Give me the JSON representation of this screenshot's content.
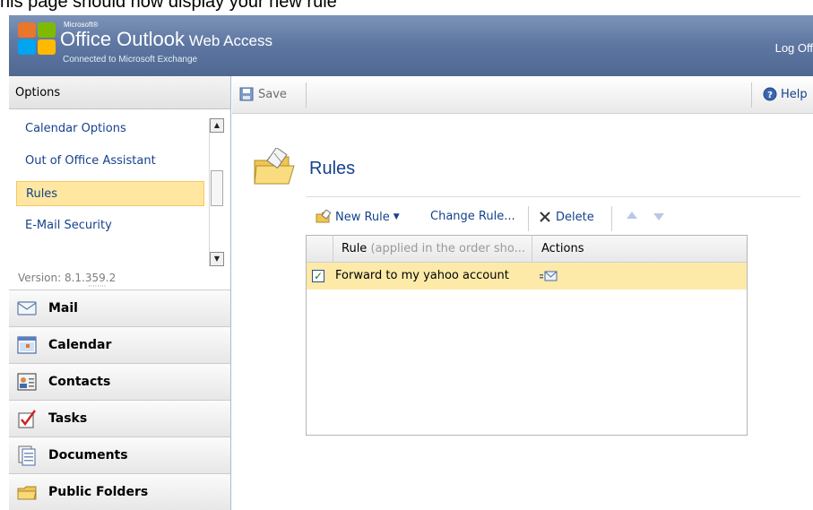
{
  "caption": "his page should now display your new rule",
  "header": {
    "microsoft": "Microsoft®",
    "product": "Office Outlook",
    "product_suffix": "Web Access",
    "subtitle": "Connected to Microsoft Exchange",
    "logoff": "Log Off"
  },
  "nav": {
    "title": "Options",
    "items": [
      {
        "label": "Calendar Options"
      },
      {
        "label": "Out of Office Assistant"
      },
      {
        "label": "Rules",
        "selected": true
      },
      {
        "label": "E-Mail Security"
      }
    ],
    "version": "Version: 8.1.359.2",
    "modules": [
      {
        "label": "Mail",
        "icon": "mail-icon"
      },
      {
        "label": "Calendar",
        "icon": "calendar-icon"
      },
      {
        "label": "Contacts",
        "icon": "contacts-icon"
      },
      {
        "label": "Tasks",
        "icon": "tasks-icon"
      },
      {
        "label": "Documents",
        "icon": "documents-icon"
      },
      {
        "label": "Public Folders",
        "icon": "public-folders-icon"
      }
    ]
  },
  "toolbar": {
    "save": "Save",
    "help": "Help"
  },
  "rules": {
    "title": "Rules",
    "toolbar": {
      "new_rule": "New Rule",
      "change_rule": "Change Rule...",
      "delete": "Delete"
    },
    "columns": {
      "rule": "Rule",
      "rule_hint": "(applied in the order sho...",
      "actions": "Actions"
    },
    "rows": [
      {
        "enabled": true,
        "name": "Forward to my yahoo account"
      }
    ]
  },
  "colors": {
    "header_blue": "#5f78a3",
    "link_blue": "#15428b",
    "selection": "#ffe7a2"
  }
}
